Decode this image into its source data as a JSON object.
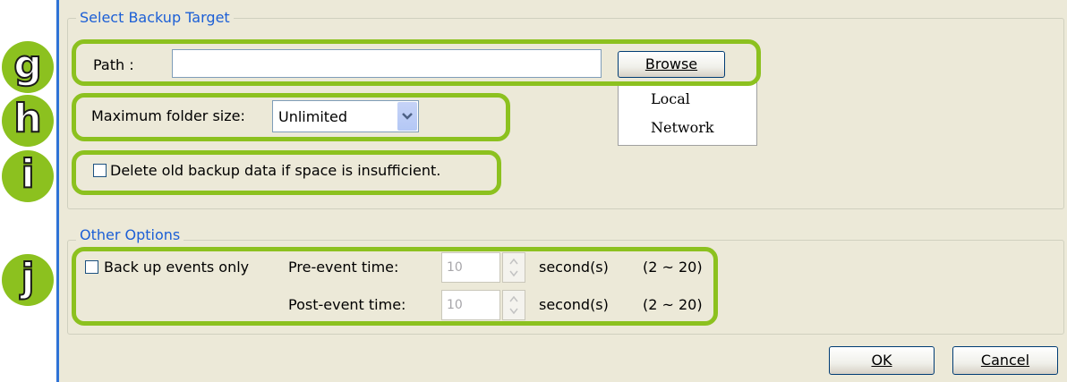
{
  "backup_target": {
    "title": "Select Backup Target",
    "path_label": "Path :",
    "path_value": "",
    "browse_label": "Browse",
    "browse_menu": [
      "Local",
      "Network"
    ],
    "max_size_label": "Maximum folder size:",
    "max_size_value": "Unlimited",
    "delete_old_label": "Delete old backup data if space is insufficient."
  },
  "other_options": {
    "title": "Other Options",
    "events_only_label": "Back up events only",
    "pre_event_label": "Pre-event time:",
    "pre_event_value": "10",
    "post_event_label": "Post-event time:",
    "post_event_value": "10",
    "unit_label": "second(s)",
    "range_label": "(2 ~ 20)"
  },
  "buttons": {
    "ok": "OK",
    "cancel": "Cancel"
  },
  "badges": [
    "g",
    "h",
    "i",
    "j"
  ],
  "colors": {
    "highlight": "#8cc11f",
    "group_title": "#1c5fd6",
    "panel": "#ece9d8"
  }
}
